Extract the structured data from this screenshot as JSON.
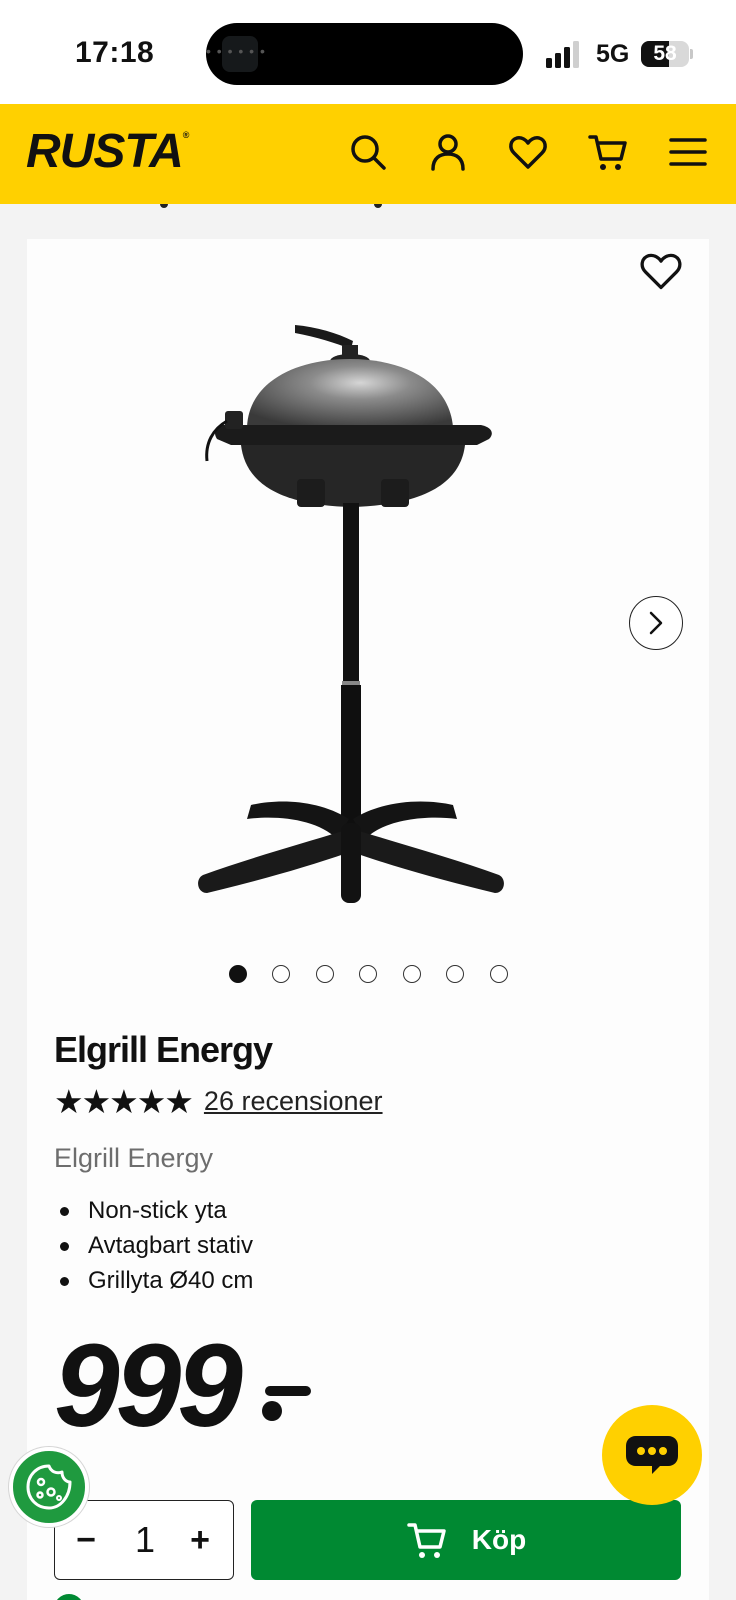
{
  "status_bar": {
    "time": "17:18",
    "network": "5G",
    "battery": "58",
    "battery_level": 0.58
  },
  "header": {
    "logo": "RUSTA",
    "icons": [
      "search-icon",
      "account-icon",
      "wishlist-icon",
      "cart-icon",
      "menu-icon"
    ],
    "brand_color": "#ffd000"
  },
  "product": {
    "image_count": 7,
    "active_image": 1,
    "title": "Elgrill Energy",
    "rating": 5,
    "stars": "★★★★★",
    "reviews_label": "26 recensioner",
    "subtitle": "Elgrill Energy",
    "features": [
      "Non-stick yta",
      "Avtagbart stativ",
      "Grillyta Ø40 cm"
    ],
    "price": "999"
  },
  "purchase": {
    "quantity": "1",
    "minus": "−",
    "plus": "+",
    "buy_label": "Köp",
    "buy_color": "#008932"
  },
  "floating": {
    "cookie_icon": "cookie-icon",
    "chat_icon": "chat-icon"
  }
}
